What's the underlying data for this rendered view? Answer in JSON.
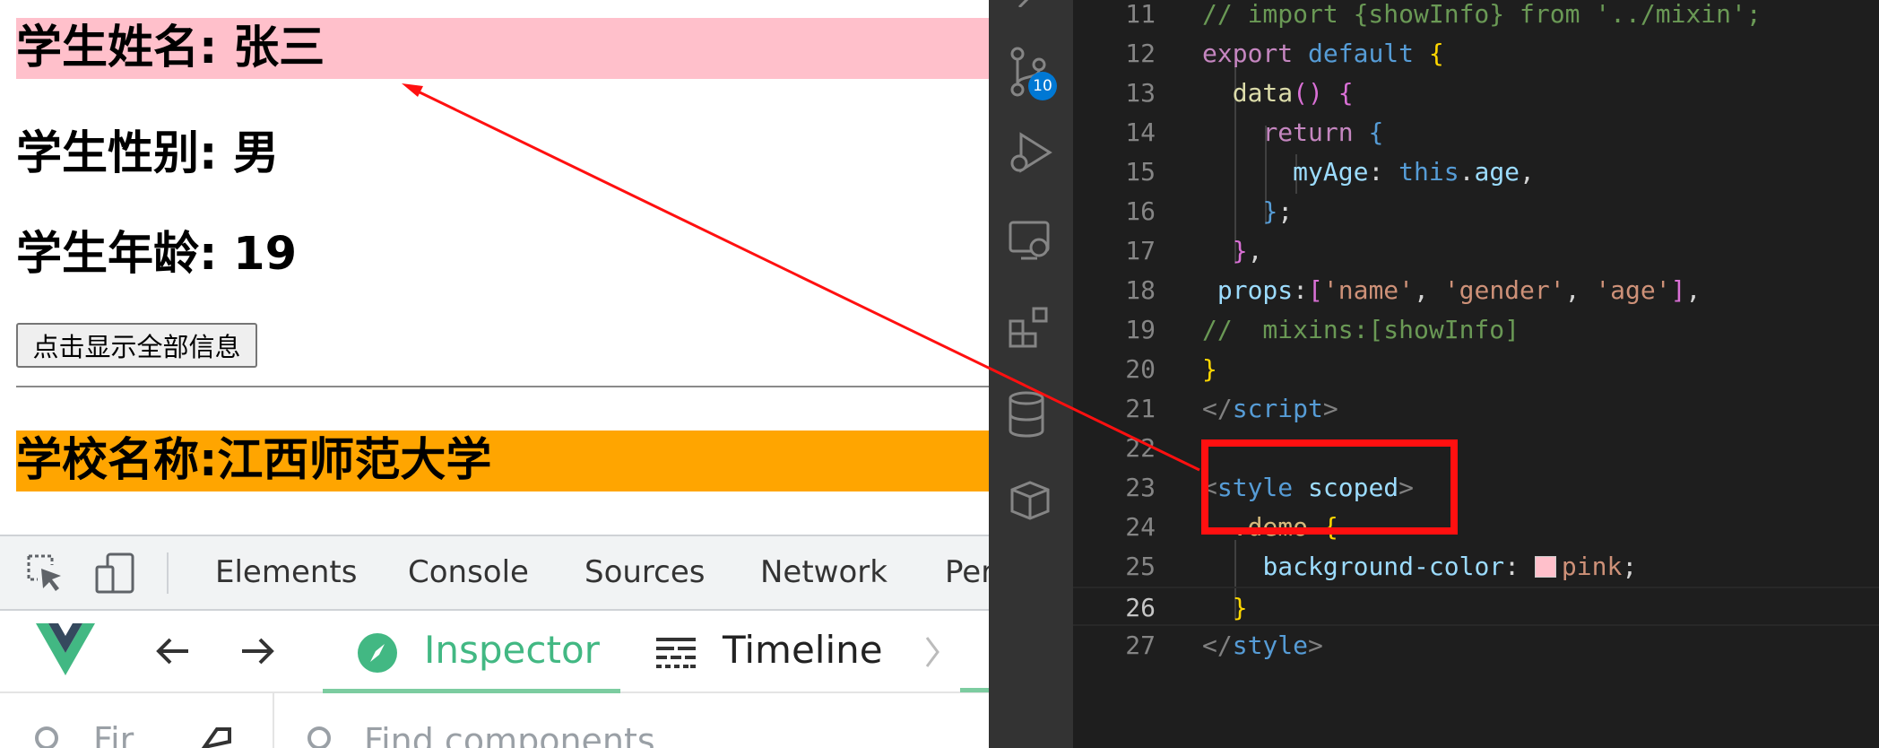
{
  "browser": {
    "student_name": "学生姓名: 张三",
    "student_gender": "学生性别: 男",
    "student_age": "学生年龄: 19",
    "show_button": "点击显示全部信息",
    "school_name": "学校名称:江西师范大学"
  },
  "devtools": {
    "tabs": [
      "Elements",
      "Console",
      "Sources",
      "Network",
      "Per"
    ]
  },
  "vue_devtools": {
    "inspector": "Inspector",
    "timeline": "Timeline",
    "filter_partial": "Fir",
    "find_placeholder": "Find components"
  },
  "vscode": {
    "scm_badge": "10",
    "lines": [
      {
        "n": "11",
        "tokens": [
          [
            "c-comment",
            "// import {showInfo} from '../mixin';"
          ]
        ]
      },
      {
        "n": "12",
        "tokens": [
          [
            "c-kw",
            "export"
          ],
          [
            "",
            " "
          ],
          [
            "c-blue",
            "default"
          ],
          [
            "",
            " "
          ],
          [
            "c-yellow",
            "{"
          ]
        ]
      },
      {
        "n": "13",
        "tokens": [
          [
            "",
            "  "
          ],
          [
            "c-func",
            "data"
          ],
          [
            "c-purple",
            "()"
          ],
          [
            "",
            " "
          ],
          [
            "c-purple",
            "{"
          ]
        ]
      },
      {
        "n": "14",
        "tokens": [
          [
            "",
            "    "
          ],
          [
            "c-kw",
            "return"
          ],
          [
            "",
            " "
          ],
          [
            "c-blue",
            "{"
          ]
        ]
      },
      {
        "n": "15",
        "tokens": [
          [
            "",
            "      "
          ],
          [
            "c-prop",
            "myAge"
          ],
          [
            "",
            ": "
          ],
          [
            "c-blue",
            "this"
          ],
          [
            "",
            "."
          ],
          [
            "c-prop",
            "age"
          ],
          [
            "",
            ","
          ]
        ]
      },
      {
        "n": "16",
        "tokens": [
          [
            "",
            "    "
          ],
          [
            "c-blue",
            "}"
          ],
          [
            "",
            ";"
          ]
        ]
      },
      {
        "n": "17",
        "tokens": [
          [
            "",
            "  "
          ],
          [
            "c-purple",
            "}"
          ],
          [
            "",
            ","
          ]
        ]
      },
      {
        "n": "18",
        "tokens": [
          [
            "",
            " "
          ],
          [
            "c-prop",
            "props"
          ],
          [
            "",
            ":"
          ],
          [
            "c-purple",
            "["
          ],
          [
            "c-str",
            "'name'"
          ],
          [
            "",
            ", "
          ],
          [
            "c-str",
            "'gender'"
          ],
          [
            "",
            ", "
          ],
          [
            "c-str",
            "'age'"
          ],
          [
            "c-purple",
            "]"
          ],
          [
            "",
            ","
          ]
        ]
      },
      {
        "n": "19",
        "tokens": [
          [
            "c-comment",
            "//  mixins:[showInfo]"
          ]
        ]
      },
      {
        "n": "20",
        "tokens": [
          [
            "c-yellow",
            "}"
          ]
        ]
      },
      {
        "n": "21",
        "tokens": [
          [
            "c-punct",
            "</"
          ],
          [
            "c-tag",
            "script"
          ],
          [
            "c-punct",
            ">"
          ]
        ]
      },
      {
        "n": "22",
        "tokens": []
      },
      {
        "n": "23",
        "tokens": [
          [
            "c-punct",
            "<"
          ],
          [
            "c-tag",
            "style"
          ],
          [
            "",
            " "
          ],
          [
            "c-attr",
            "scoped"
          ],
          [
            "c-punct",
            ">"
          ]
        ]
      },
      {
        "n": "24",
        "tokens": [
          [
            "",
            "  "
          ],
          [
            "c-sel",
            ".demo"
          ],
          [
            "",
            " "
          ],
          [
            "c-yellow",
            "{"
          ]
        ]
      },
      {
        "n": "25",
        "tokens": [
          [
            "",
            "    "
          ],
          [
            "c-prop",
            "background-color"
          ],
          [
            "",
            ": "
          ],
          [
            "swatch",
            ""
          ],
          [
            "c-str",
            "pink"
          ],
          [
            "",
            ";"
          ]
        ]
      },
      {
        "n": "26",
        "tokens": [
          [
            "",
            "  "
          ],
          [
            "c-yellow",
            "}"
          ]
        ]
      },
      {
        "n": "27",
        "tokens": [
          [
            "c-punct",
            "</"
          ],
          [
            "c-tag",
            "style"
          ],
          [
            "c-punct",
            ">"
          ]
        ]
      }
    ]
  },
  "colors": {
    "name_bg": "#ffc0cb",
    "school_bg": "#ffa500",
    "vue_green": "#42b883",
    "annotation_red": "#ff1010"
  }
}
